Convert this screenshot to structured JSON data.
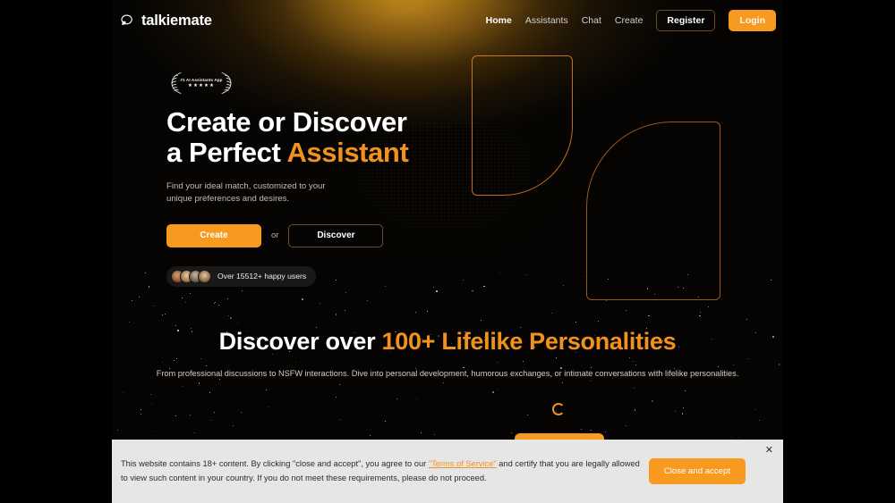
{
  "nav": {
    "brand": "talkiemate",
    "brand_icon": "chat-bubble-icon",
    "links": [
      {
        "label": "Home",
        "active": true
      },
      {
        "label": "Assistants",
        "active": false
      },
      {
        "label": "Chat",
        "active": false
      },
      {
        "label": "Create",
        "active": false
      }
    ],
    "register_label": "Register",
    "login_label": "Login"
  },
  "hero": {
    "badge_text": "#1 AI Assistants App",
    "badge_stars": "★★★★★",
    "title_line1": "Create or Discover",
    "title_line2_plain": "a Perfect ",
    "title_line2_accent": "Assistant",
    "subtitle": "Find your ideal match, customized to your unique preferences and desires.",
    "cta_primary": "Create",
    "cta_separator": "or",
    "cta_secondary": "Discover",
    "social_proof": "Over 15512+ happy users"
  },
  "section2": {
    "title_plain": "Discover over ",
    "title_accent": "100+ Lifelike Personalities",
    "description": "From professional discussions to NSFW interactions. Dive into personal development, humorous exchanges, or intimate conversations with lifelike personalities."
  },
  "banner": {
    "text_part1": "This website contains 18+ content. By clicking \"close and accept\", you agree to our ",
    "link_label": "\"Terms of Service\"",
    "text_part2": " and certify that you are legally allowed to view such content in your country. If you do not meet these requirements, please do not proceed.",
    "accept_label": "Close and accept",
    "close_icon": "close-icon"
  },
  "colors": {
    "accent_orange": "#F79A1F",
    "accent_orange_text": "#F2921D",
    "page_background": "#050403",
    "banner_background": "#e6e6e6"
  }
}
